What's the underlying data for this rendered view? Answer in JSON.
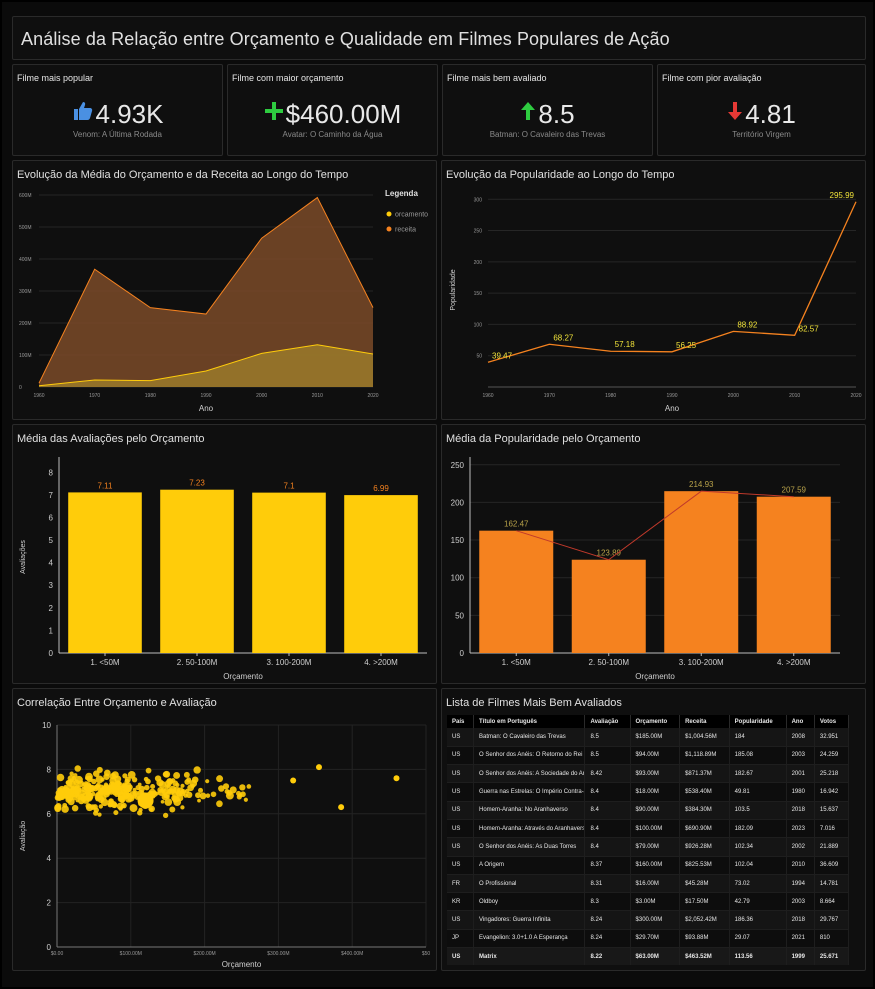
{
  "page": {
    "title": "Análise da Relação entre Orçamento e Qualidade em Filmes Populares de Ação"
  },
  "kpis": [
    {
      "title": "Filme mais popular",
      "value": "4.93K",
      "subtitle": "Venom: A Última Rodada",
      "icon": "thumbs-up-icon",
      "color": "#4a90e2"
    },
    {
      "title": "Filme com maior orçamento",
      "value": "$460.00M",
      "subtitle": "Avatar: O Caminho da Água",
      "icon": "plus-icon",
      "color": "#2ecc40"
    },
    {
      "title": "Filme mais bem avaliado",
      "value": "8.5",
      "subtitle": "Batman: O Cavaleiro das Trevas",
      "icon": "arrow-up-icon",
      "color": "#2ecc40"
    },
    {
      "title": "Filme com pior avaliação",
      "value": "4.81",
      "subtitle": "Território Virgem",
      "icon": "arrow-down-icon",
      "color": "#e53935"
    }
  ],
  "colors": {
    "yellow": "#ffcc0a",
    "orange": "#f5821f",
    "revenue_fill": "#7a4a28",
    "budget_fill": "#9a7a2a"
  },
  "chart_data": [
    {
      "id": "budget_revenue_time",
      "type": "area",
      "title": "Evolução da Média do Orçamento e da Receita ao Longo do Tempo",
      "xlabel": "Ano",
      "ylabel": "",
      "x": [
        1960,
        1970,
        1980,
        1990,
        2000,
        2010,
        2020
      ],
      "x_ticks": [
        "1960",
        "1970",
        "1980",
        "1990",
        "2000",
        "2010",
        "2020"
      ],
      "ylim": [
        0,
        600000000
      ],
      "y_ticks": [
        "0",
        "100M",
        "200M",
        "300M",
        "400M",
        "500M",
        "600M"
      ],
      "legend": {
        "title": "Legenda",
        "position": "top-right"
      },
      "series": [
        {
          "name": "orcamento",
          "color": "#ffcc0a",
          "values": [
            4000000,
            22000000,
            20000000,
            50000000,
            105000000,
            132000000,
            103000000
          ]
        },
        {
          "name": "receita",
          "color": "#f5821f",
          "values": [
            12000000,
            368000000,
            248000000,
            228000000,
            465000000,
            592000000,
            248000000
          ]
        }
      ]
    },
    {
      "id": "popularity_time",
      "type": "line",
      "title": "Evolução da Popularidade ao Longo do Tempo",
      "xlabel": "Ano",
      "ylabel": "Popularidade",
      "x": [
        1960,
        1970,
        1980,
        1990,
        2000,
        2010,
        2020
      ],
      "x_ticks": [
        "1960",
        "1970",
        "1980",
        "1990",
        "2000",
        "2010",
        "2020"
      ],
      "ylim": [
        0,
        310
      ],
      "y_ticks": [
        50,
        100,
        150,
        200,
        250,
        300
      ],
      "series": [
        {
          "color": "#f5821f",
          "values": [
            39.47,
            68.27,
            57.18,
            56.25,
            88.92,
            82.57,
            295.99
          ],
          "labels": [
            "39.47",
            "68.27",
            "57.18",
            "56.25",
            "88.92",
            "82.57",
            "295.99"
          ]
        }
      ]
    },
    {
      "id": "rating_by_budget",
      "type": "bar",
      "title": "Média das Avaliações pelo Orçamento",
      "xlabel": "Orçamento",
      "ylabel": "Avaliações",
      "categories": [
        "1. <50M",
        "2. 50-100M",
        "3. 100-200M",
        "4. >200M"
      ],
      "values": [
        7.11,
        7.23,
        7.1,
        6.99
      ],
      "labels": [
        "7.11",
        "7.23",
        "7.1",
        "6.99"
      ],
      "ylim": [
        0,
        8.5
      ],
      "y_ticks": [
        0,
        1,
        2,
        3,
        4,
        5,
        6,
        7,
        8
      ],
      "color": "#ffcc0a"
    },
    {
      "id": "popularity_by_budget",
      "type": "bar",
      "title": "Média da Popularidade pelo Orçamento",
      "xlabel": "Orçamento",
      "ylabel": "",
      "categories": [
        "1. <50M",
        "2. 50-100M",
        "3. 100-200M",
        "4. >200M"
      ],
      "values": [
        162.47,
        123.89,
        214.93,
        207.59
      ],
      "labels": [
        "162.47",
        "123.89",
        "214.93",
        "207.59"
      ],
      "ylim": [
        0,
        255
      ],
      "y_ticks": [
        0,
        50,
        100,
        150,
        200,
        250
      ],
      "color": "#f5821f",
      "overlay_line": true
    },
    {
      "id": "budget_rating_scatter",
      "type": "scatter",
      "title": "Correlação Entre Orçamento e Avaliação",
      "xlabel": "Orçamento",
      "ylabel": "Avaliação",
      "xlim": [
        0,
        500000000
      ],
      "x_ticks": [
        "$0.00",
        "$100.00M",
        "$200.00M",
        "$300.00M",
        "$400.00M",
        "$50"
      ],
      "ylim": [
        0,
        10
      ],
      "y_ticks": [
        0,
        2,
        4,
        6,
        8,
        10
      ],
      "color": "#ffcc0a",
      "point_count": 320,
      "highlighted_points": [
        {
          "x": 120000000,
          "y": 6.6
        },
        {
          "x": 460000000,
          "y": 7.6
        },
        {
          "x": 385000000,
          "y": 6.3
        },
        {
          "x": 355000000,
          "y": 8.1
        },
        {
          "x": 320000000,
          "y": 7.5
        }
      ]
    }
  ],
  "table": {
    "title": "Lista de Filmes Mais Bem Avaliados",
    "columns": [
      "País",
      "Título em Português",
      "Avaliação",
      "Orçamento",
      "Receita",
      "Popularidade",
      "Ano",
      "Votos"
    ],
    "rows": [
      [
        "US",
        "Batman: O Cavaleiro das Trevas",
        "8.5",
        "$185.00M",
        "$1,004.56M",
        "184",
        "2008",
        "32.951"
      ],
      [
        "US",
        "O Senhor dos Anéis: O Retorno do Rei",
        "8.5",
        "$94.00M",
        "$1,118.89M",
        "185.08",
        "2003",
        "24.259"
      ],
      [
        "US",
        "O Senhor dos Anéis: A Sociedade do Anel",
        "8.42",
        "$93.00M",
        "$871.37M",
        "182.67",
        "2001",
        "25.218"
      ],
      [
        "US",
        "Guerra nas Estrelas: O Império Contra-Ataca",
        "8.4",
        "$18.00M",
        "$538.40M",
        "49.81",
        "1980",
        "16.942"
      ],
      [
        "US",
        "Homem-Aranha: No Aranhaverso",
        "8.4",
        "$90.00M",
        "$384.30M",
        "103.5",
        "2018",
        "15.637"
      ],
      [
        "US",
        "Homem-Aranha: Através do Aranhaverso",
        "8.4",
        "$100.00M",
        "$690.90M",
        "182.09",
        "2023",
        "7.016"
      ],
      [
        "US",
        "O Senhor dos Anéis: As Duas Torres",
        "8.4",
        "$79.00M",
        "$926.28M",
        "102.34",
        "2002",
        "21.889"
      ],
      [
        "US",
        "A Origem",
        "8.37",
        "$160.00M",
        "$825.53M",
        "102.04",
        "2010",
        "36.609"
      ],
      [
        "FR",
        "O Profissional",
        "8.31",
        "$16.00M",
        "$45.28M",
        "73.02",
        "1994",
        "14.781"
      ],
      [
        "KR",
        "Oldboy",
        "8.3",
        "$3.00M",
        "$17.50M",
        "42.79",
        "2003",
        "8.664"
      ],
      [
        "US",
        "Vingadores: Guerra Infinita",
        "8.24",
        "$300.00M",
        "$2,052.42M",
        "186.36",
        "2018",
        "29.767"
      ],
      [
        "JP",
        "Evangelion: 3.0+1.0 A Esperança",
        "8.24",
        "$29.70M",
        "$93.88M",
        "29.07",
        "2021",
        "810"
      ]
    ],
    "total": [
      "US",
      "Matrix",
      "8.22",
      "$63.00M",
      "$463.52M",
      "113.56",
      "1999",
      "25.671"
    ]
  }
}
